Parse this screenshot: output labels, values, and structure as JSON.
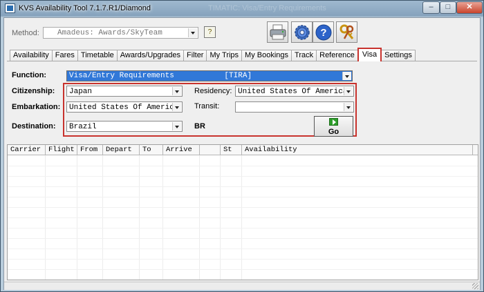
{
  "window": {
    "title": "KVS Availability Tool 7.1.7.R1/Diamond",
    "faded_title": "TIMATIC: Visa/Entry Requirements",
    "minimize": "–",
    "maximize": "□",
    "close": "✕"
  },
  "method": {
    "label": "Method:",
    "value": "Amadeus: Awards/SkyTeam",
    "info_button": "?"
  },
  "toolbar": {
    "print": "printer-icon",
    "settings": "gear-icon",
    "help": "help-icon",
    "keys": "keys-icon"
  },
  "tabs": [
    {
      "label": "Availability",
      "active": false
    },
    {
      "label": "Fares",
      "active": false
    },
    {
      "label": "Timetable",
      "active": false
    },
    {
      "label": "Awards/Upgrades",
      "active": false
    },
    {
      "label": "Filter",
      "active": false
    },
    {
      "label": "My Trips",
      "active": false
    },
    {
      "label": "My Bookings",
      "active": false
    },
    {
      "label": "Track",
      "active": false
    },
    {
      "label": "Reference",
      "active": false
    },
    {
      "label": "Visa",
      "active": true
    },
    {
      "label": "Settings",
      "active": false
    }
  ],
  "form": {
    "function_label": "Function:",
    "function_value": "Visa/Entry Requirements           [TIRA]",
    "citizenship_label": "Citizenship:",
    "citizenship_value": "Japan",
    "embarkation_label": "Embarkation:",
    "embarkation_value": "United States Of America",
    "destination_label": "Destination:",
    "destination_value": "Brazil",
    "destination_code": "BR",
    "residency_label": "Residency:",
    "residency_value": "United States Of America",
    "transit_label": "Transit:",
    "transit_value": "",
    "go_label": "Go"
  },
  "grid": {
    "columns": [
      "Carrier",
      "Flight",
      "From",
      "Depart",
      "To",
      "Arrive",
      "",
      "St",
      "Availability"
    ]
  },
  "colors": {
    "highlight_red": "#c8322d",
    "selection_blue": "#3178d8"
  }
}
